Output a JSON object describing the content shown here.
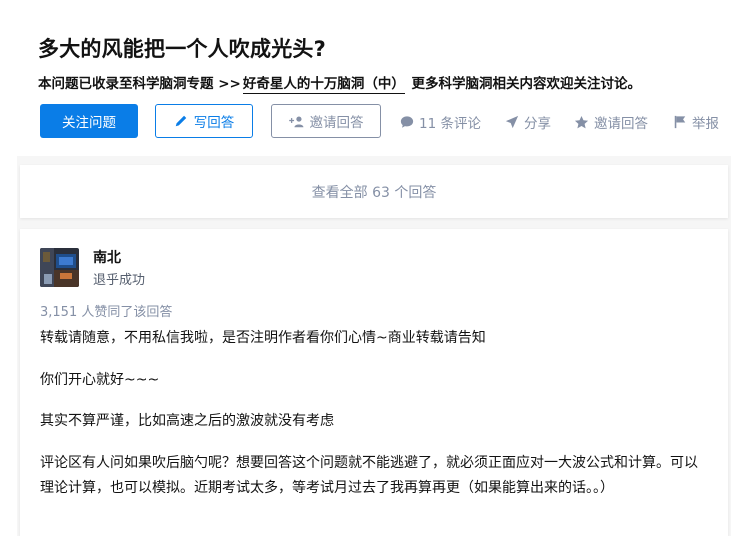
{
  "question": {
    "title": "多大的风能把一个人吹成光头?",
    "topic_prefix": "本问题已收录至科学脑洞专题 >>",
    "topic_link": "好奇星人的十万脑洞（中）",
    "topic_suffix": "更多科学脑洞相关内容欢迎关注讨论。"
  },
  "buttons": {
    "follow": "关注问题",
    "write": "写回答",
    "invite": "邀请回答"
  },
  "actions": {
    "comments": "11 条评论",
    "share": "分享",
    "invite": "邀请回答",
    "report": "举报"
  },
  "view_all": "查看全部 63 个回答",
  "answer": {
    "author_name": "南北",
    "author_bio": "退乎成功",
    "votes": "3,151 人赞同了该回答",
    "paragraphs": [
      "转载请随意，不用私信我啦，是否注明作者看你们心情~商业转载请告知",
      "你们开心就好~~~",
      "其实不算严谨，比如高速之后的激波就没有考虑",
      "评论区有人问如果吹后脑勺呢？想要回答这个问题就不能逃避了，就必须正面应对一大波公式和计算。可以理论计算，也可以模拟。近期考试太多，等考试月过去了我再算再更（如果能算出来的话。。）"
    ]
  },
  "colors": {
    "primary": "#0a7de7",
    "muted": "#8590a6",
    "text": "#121212",
    "page_bg": "#f6f6f6"
  },
  "icons": [
    "pencil-icon",
    "add-user-icon",
    "comment-icon",
    "share-icon",
    "star-icon",
    "flag-icon"
  ]
}
